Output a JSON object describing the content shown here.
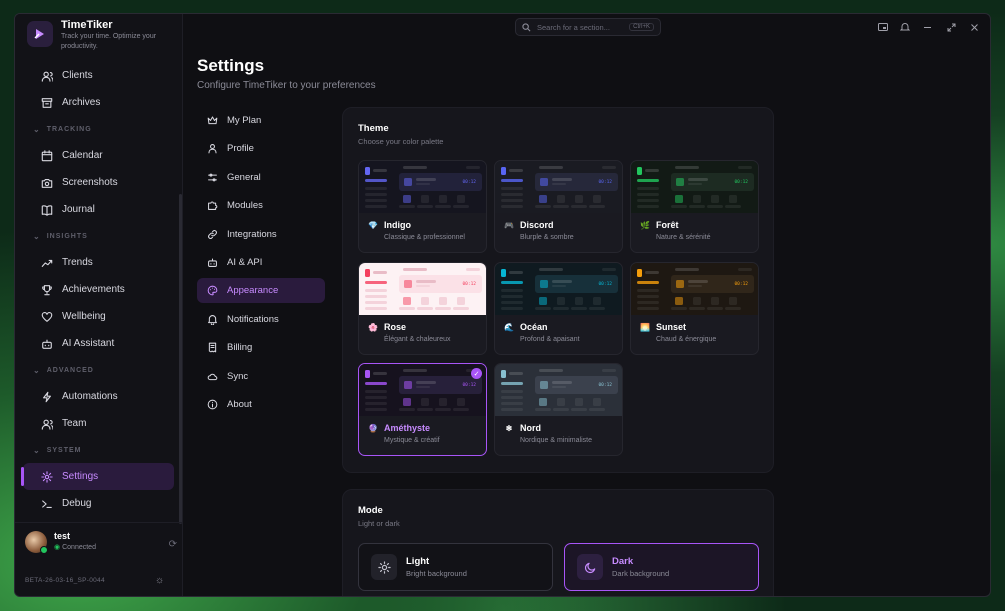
{
  "app": {
    "name": "TimeTiker",
    "tagline": "Track your time. Optimize your productivity."
  },
  "search": {
    "placeholder": "Search for a section...",
    "shortcut": "Ctrl+K"
  },
  "sidebar": {
    "items_top": [
      {
        "label": "Clients",
        "icon": "users-icon"
      },
      {
        "label": "Archives",
        "icon": "archive-icon"
      }
    ],
    "sections": [
      {
        "title": "TRACKING",
        "items": [
          {
            "label": "Calendar",
            "icon": "calendar-icon"
          },
          {
            "label": "Screenshots",
            "icon": "camera-icon"
          },
          {
            "label": "Journal",
            "icon": "book-icon"
          }
        ]
      },
      {
        "title": "INSIGHTS",
        "items": [
          {
            "label": "Trends",
            "icon": "trend-icon"
          },
          {
            "label": "Achievements",
            "icon": "trophy-icon"
          },
          {
            "label": "Wellbeing",
            "icon": "heart-icon"
          },
          {
            "label": "AI Assistant",
            "icon": "bot-icon"
          }
        ]
      },
      {
        "title": "ADVANCED",
        "items": [
          {
            "label": "Automations",
            "icon": "zap-icon"
          },
          {
            "label": "Team",
            "icon": "users-icon"
          }
        ]
      },
      {
        "title": "SYSTEM",
        "items": [
          {
            "label": "Settings",
            "icon": "gear-icon",
            "active": true
          },
          {
            "label": "Debug",
            "icon": "terminal-icon"
          }
        ]
      }
    ],
    "user": {
      "name": "test",
      "status": "Connected"
    },
    "version": "BETA-26-03-16_SP-0044"
  },
  "page": {
    "title": "Settings",
    "subtitle": "Configure TimeTiker to your preferences"
  },
  "settings_nav": [
    {
      "label": "My Plan",
      "icon": "crown-icon"
    },
    {
      "label": "Profile",
      "icon": "user-icon"
    },
    {
      "label": "General",
      "icon": "sliders-icon"
    },
    {
      "label": "Modules",
      "icon": "puzzle-icon"
    },
    {
      "label": "Integrations",
      "icon": "link-icon"
    },
    {
      "label": "AI & API",
      "icon": "bot-icon"
    },
    {
      "label": "Appearance",
      "icon": "palette-icon",
      "active": true
    },
    {
      "label": "Notifications",
      "icon": "bell-icon"
    },
    {
      "label": "Billing",
      "icon": "receipt-icon"
    },
    {
      "label": "Sync",
      "icon": "cloud-icon"
    },
    {
      "label": "About",
      "icon": "info-icon"
    }
  ],
  "theme_section": {
    "title": "Theme",
    "subtitle": "Choose your color palette"
  },
  "themes": [
    {
      "name": "Indigo",
      "desc": "Classique & professionnel",
      "glyph": "💎",
      "accent": "#6366f1",
      "bg": "#15151f",
      "panel": "#22223a",
      "light": false
    },
    {
      "name": "Discord",
      "desc": "Blurple & sombre",
      "glyph": "🎮",
      "accent": "#5865f2",
      "bg": "#1a1b22",
      "panel": "#26283a",
      "light": false
    },
    {
      "name": "Forêt",
      "desc": "Nature & sérénité",
      "glyph": "🌿",
      "accent": "#22c55e",
      "bg": "#121a15",
      "panel": "#1d2b22",
      "light": false
    },
    {
      "name": "Rose",
      "desc": "Élégant & chaleureux",
      "glyph": "🌸",
      "accent": "#f43f5e",
      "bg": "#fdf2f4",
      "panel": "#fbe1e7",
      "light": true
    },
    {
      "name": "Océan",
      "desc": "Profond & apaisant",
      "glyph": "🌊",
      "accent": "#06b6d4",
      "bg": "#0f1a20",
      "panel": "#17303a",
      "light": false
    },
    {
      "name": "Sunset",
      "desc": "Chaud & énergique",
      "glyph": "🌅",
      "accent": "#f59e0b",
      "bg": "#1e1812",
      "panel": "#30261a",
      "light": false
    },
    {
      "name": "Améthyste",
      "desc": "Mystique & créatif",
      "glyph": "🔮",
      "accent": "#a855f7",
      "bg": "#16121e",
      "panel": "#27203a",
      "light": false,
      "selected": true
    },
    {
      "name": "Nord",
      "desc": "Nordique & minimaliste",
      "glyph": "❄",
      "accent": "#88c0d0",
      "bg": "#2b3039",
      "panel": "#3b414d",
      "light": false
    }
  ],
  "mode_section": {
    "title": "Mode",
    "subtitle": "Light or dark"
  },
  "modes": [
    {
      "name": "Light",
      "desc": "Bright background",
      "icon": "sun-icon"
    },
    {
      "name": "Dark",
      "desc": "Dark background",
      "icon": "moon-icon",
      "selected": true
    }
  ],
  "preview_value": "00:12",
  "colors": {
    "accent": "#a855f7",
    "active_text": "#c78bff",
    "active_bg": "#2a1b3d"
  }
}
